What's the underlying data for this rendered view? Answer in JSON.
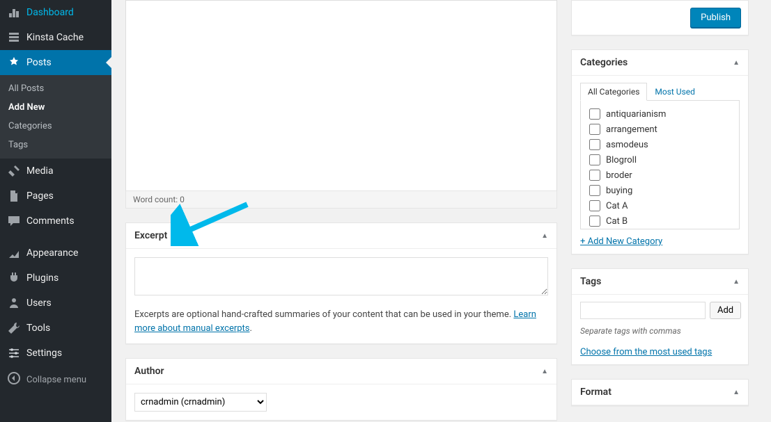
{
  "sidebar": {
    "dashboard": "Dashboard",
    "kinsta_cache": "Kinsta Cache",
    "posts": "Posts",
    "submenu": {
      "all_posts": "All Posts",
      "add_new": "Add New",
      "categories": "Categories",
      "tags": "Tags"
    },
    "media": "Media",
    "pages": "Pages",
    "comments": "Comments",
    "appearance": "Appearance",
    "plugins": "Plugins",
    "users": "Users",
    "tools": "Tools",
    "settings": "Settings",
    "collapse": "Collapse menu"
  },
  "editor": {
    "word_count_label": "Word count: 0"
  },
  "excerpt": {
    "title": "Excerpt",
    "value": "",
    "description_prefix": "Excerpts are optional hand-crafted summaries of your content that can be used in your theme. ",
    "description_link": "Learn more about manual excerpts",
    "description_suffix": "."
  },
  "author": {
    "title": "Author",
    "selected": "crnadmin (crnadmin)"
  },
  "publish": {
    "button": "Publish"
  },
  "categories": {
    "title": "Categories",
    "tab_all": "All Categories",
    "tab_most_used": "Most Used",
    "items": [
      "antiquarianism",
      "arrangement",
      "asmodeus",
      "Blogroll",
      "broder",
      "buying",
      "Cat A",
      "Cat B"
    ],
    "add_new": "+ Add New Category"
  },
  "tags": {
    "title": "Tags",
    "input_value": "",
    "add_button": "Add",
    "hint": "Separate tags with commas",
    "cloud_link": "Choose from the most used tags"
  },
  "format": {
    "title": "Format"
  }
}
